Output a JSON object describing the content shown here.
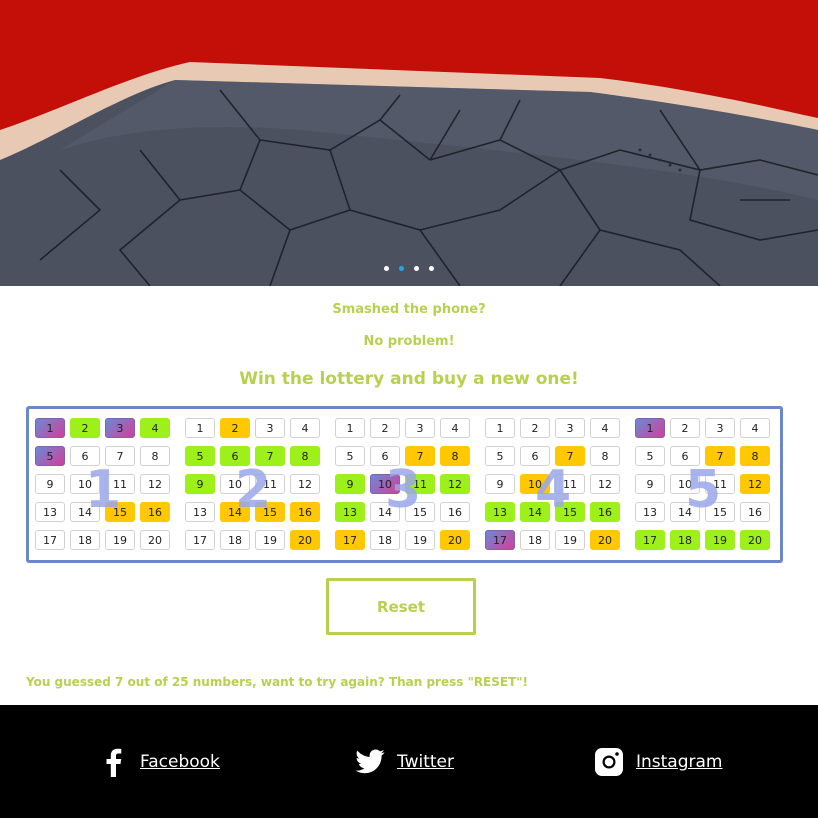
{
  "hero": {
    "slides": 4,
    "active_slide": 1
  },
  "texts": {
    "line1": "Smashed the phone?",
    "line2": "No problem!",
    "line3": "Win the lottery and buy a new one!"
  },
  "tickets": [
    {
      "label": "1",
      "cells": [
        [
          "1",
          "p"
        ],
        [
          "2",
          "g"
        ],
        [
          "3",
          "p"
        ],
        [
          "4",
          "g"
        ],
        [
          "5",
          "p"
        ],
        [
          "6",
          ""
        ],
        [
          "7",
          ""
        ],
        [
          "8",
          ""
        ],
        [
          "9",
          ""
        ],
        [
          "10",
          ""
        ],
        [
          "11",
          ""
        ],
        [
          "12",
          ""
        ],
        [
          "13",
          ""
        ],
        [
          "14",
          ""
        ],
        [
          "15",
          "y"
        ],
        [
          "16",
          "y"
        ],
        [
          "17",
          ""
        ],
        [
          "18",
          ""
        ],
        [
          "19",
          ""
        ],
        [
          "20",
          ""
        ]
      ]
    },
    {
      "label": "2",
      "cells": [
        [
          "1",
          ""
        ],
        [
          "2",
          "y"
        ],
        [
          "3",
          ""
        ],
        [
          "4",
          ""
        ],
        [
          "5",
          "g"
        ],
        [
          "6",
          "g"
        ],
        [
          "7",
          "g"
        ],
        [
          "8",
          "g"
        ],
        [
          "9",
          "g"
        ],
        [
          "10",
          ""
        ],
        [
          "11",
          ""
        ],
        [
          "12",
          ""
        ],
        [
          "13",
          ""
        ],
        [
          "14",
          "y"
        ],
        [
          "15",
          "y"
        ],
        [
          "16",
          "y"
        ],
        [
          "17",
          ""
        ],
        [
          "18",
          ""
        ],
        [
          "19",
          ""
        ],
        [
          "20",
          "y"
        ]
      ]
    },
    {
      "label": "3",
      "cells": [
        [
          "1",
          ""
        ],
        [
          "2",
          ""
        ],
        [
          "3",
          ""
        ],
        [
          "4",
          ""
        ],
        [
          "5",
          ""
        ],
        [
          "6",
          ""
        ],
        [
          "7",
          "y"
        ],
        [
          "8",
          "y"
        ],
        [
          "9",
          "g"
        ],
        [
          "10",
          "p"
        ],
        [
          "11",
          "g"
        ],
        [
          "12",
          "g"
        ],
        [
          "13",
          "g"
        ],
        [
          "14",
          ""
        ],
        [
          "15",
          ""
        ],
        [
          "16",
          ""
        ],
        [
          "17",
          "y"
        ],
        [
          "18",
          ""
        ],
        [
          "19",
          ""
        ],
        [
          "20",
          "y"
        ]
      ]
    },
    {
      "label": "4",
      "cells": [
        [
          "1",
          ""
        ],
        [
          "2",
          ""
        ],
        [
          "3",
          ""
        ],
        [
          "4",
          ""
        ],
        [
          "5",
          ""
        ],
        [
          "6",
          ""
        ],
        [
          "7",
          "y"
        ],
        [
          "8",
          ""
        ],
        [
          "9",
          ""
        ],
        [
          "10",
          "y"
        ],
        [
          "11",
          ""
        ],
        [
          "12",
          ""
        ],
        [
          "13",
          "g"
        ],
        [
          "14",
          "g"
        ],
        [
          "15",
          "g"
        ],
        [
          "16",
          "g"
        ],
        [
          "17",
          "p"
        ],
        [
          "18",
          ""
        ],
        [
          "19",
          ""
        ],
        [
          "20",
          "y"
        ]
      ]
    },
    {
      "label": "5",
      "cells": [
        [
          "1",
          "p"
        ],
        [
          "2",
          ""
        ],
        [
          "3",
          ""
        ],
        [
          "4",
          ""
        ],
        [
          "5",
          ""
        ],
        [
          "6",
          ""
        ],
        [
          "7",
          "y"
        ],
        [
          "8",
          "y"
        ],
        [
          "9",
          ""
        ],
        [
          "10",
          ""
        ],
        [
          "11",
          ""
        ],
        [
          "12",
          "y"
        ],
        [
          "13",
          ""
        ],
        [
          "14",
          ""
        ],
        [
          "15",
          ""
        ],
        [
          "16",
          ""
        ],
        [
          "17",
          "g"
        ],
        [
          "18",
          "g"
        ],
        [
          "19",
          "g"
        ],
        [
          "20",
          "g"
        ]
      ]
    }
  ],
  "colors": {
    "accent": "#b7d14f",
    "match_green": "#9ef01a",
    "match_yellow": "#ffc800",
    "board_border": "#6a87c8"
  },
  "reset_label": "Reset",
  "result_text": "You guessed 7 out of 25 numbers, want to try again? Than press \"RESET\"!",
  "footer": {
    "facebook": {
      "label": "Facebook",
      "icon": "facebook-icon"
    },
    "twitter": {
      "label": "Twitter",
      "icon": "twitter-icon"
    },
    "instagram": {
      "label": "Instagram",
      "icon": "instagram-icon"
    }
  }
}
